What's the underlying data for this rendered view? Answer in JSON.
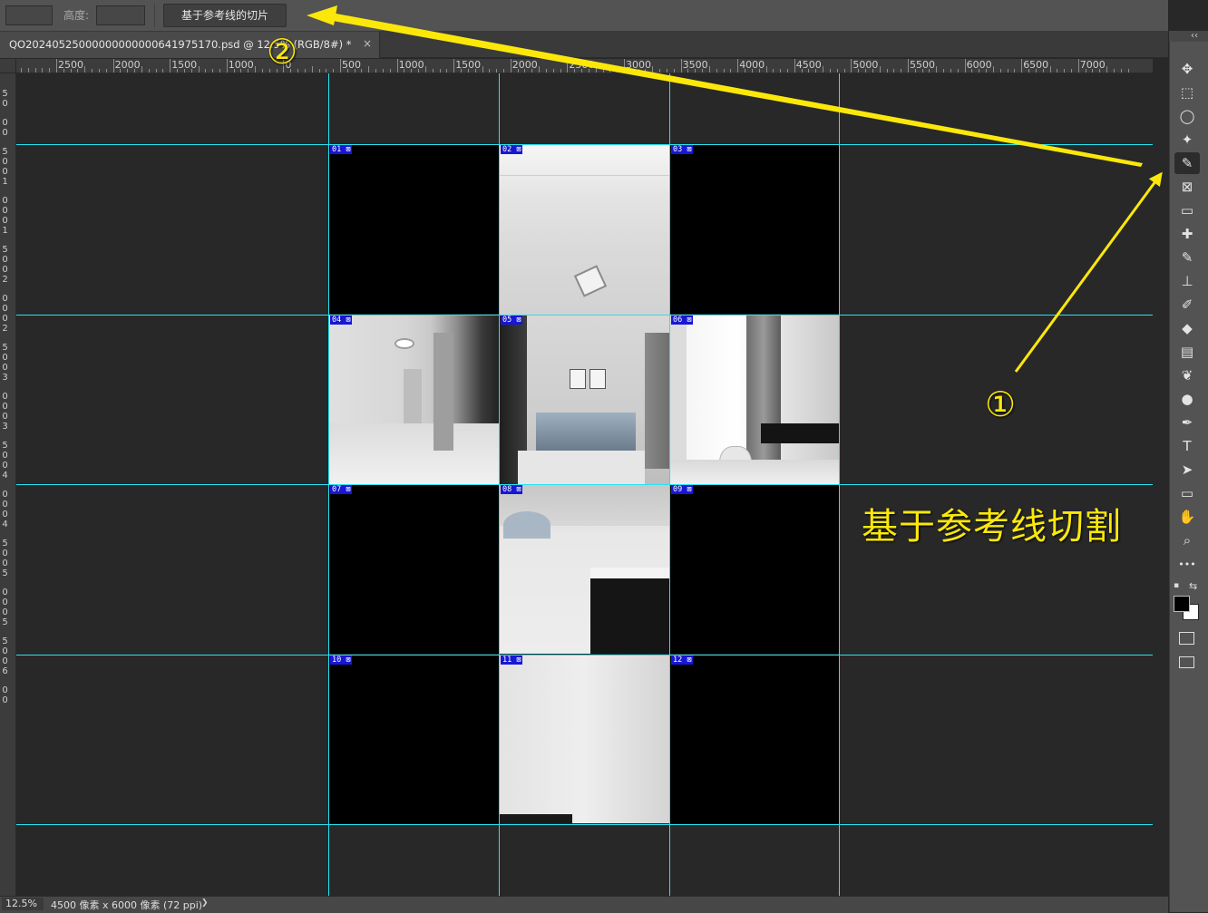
{
  "options_bar": {
    "height_label": "高度:",
    "slice_button": "基于参考线的切片"
  },
  "document_tab": {
    "title": "QO20240525000000000000641975170.psd @ 12.5% (RGB/8#) *",
    "close_label": "×"
  },
  "ruler": {
    "h_labels": [
      "2500",
      "2000",
      "1500",
      "1000",
      "0",
      "500",
      "1000",
      "1500",
      "2000",
      "2500",
      "3000",
      "3500",
      "4000",
      "4500",
      "5000",
      "5500",
      "6000",
      "6500",
      "7000"
    ],
    "v_labels": [
      "5",
      "0",
      "0",
      "0",
      "5",
      "0",
      "0",
      "1",
      "0",
      "0",
      "0",
      "1",
      "5",
      "0",
      "0",
      "2",
      "0",
      "0",
      "0",
      "2",
      "5",
      "0",
      "0",
      "3",
      "0",
      "0",
      "0",
      "3",
      "5",
      "0",
      "0",
      "4",
      "0",
      "0",
      "0",
      "4",
      "5",
      "0",
      "0",
      "5",
      "0",
      "0",
      "0",
      "5",
      "5",
      "0",
      "0",
      "6",
      "0",
      "0"
    ]
  },
  "slices": [
    {
      "id": "01",
      "image": "black"
    },
    {
      "id": "02",
      "image": "ceiling-light"
    },
    {
      "id": "03",
      "image": "black"
    },
    {
      "id": "04",
      "image": "corridor"
    },
    {
      "id": "05",
      "image": "bedroom"
    },
    {
      "id": "06",
      "image": "window-desk"
    },
    {
      "id": "07",
      "image": "black"
    },
    {
      "id": "08",
      "image": "floor-bed-end"
    },
    {
      "id": "09",
      "image": "black"
    },
    {
      "id": "10",
      "image": "black"
    },
    {
      "id": "11",
      "image": "wall-white"
    },
    {
      "id": "12",
      "image": "black"
    }
  ],
  "annotations": {
    "caption": "基于参考线切割",
    "marker_1": "①",
    "marker_2": "②",
    "arrow_color": "#fbe80a"
  },
  "status_bar": {
    "zoom": "12.5%",
    "dimensions": "4500 像素 x 6000 像素 (72 ppi)",
    "expand_arrow": "❯"
  },
  "tools": {
    "collapse": "‹‹",
    "items": [
      {
        "name": "move-tool",
        "glyph": "✥"
      },
      {
        "name": "marquee-tool",
        "glyph": "⬚"
      },
      {
        "name": "lasso-tool",
        "glyph": "◯"
      },
      {
        "name": "magic-wand-tool",
        "glyph": "✦"
      },
      {
        "name": "slice-tool",
        "glyph": "✎",
        "active": true
      },
      {
        "name": "frame-tool",
        "glyph": "⊠"
      },
      {
        "name": "ruler-tool",
        "glyph": "▭"
      },
      {
        "name": "healing-tool",
        "glyph": "✚"
      },
      {
        "name": "brush-tool",
        "glyph": "✎"
      },
      {
        "name": "stamp-tool",
        "glyph": "⊥"
      },
      {
        "name": "history-brush-tool",
        "glyph": "✐"
      },
      {
        "name": "eraser-tool",
        "glyph": "◆"
      },
      {
        "name": "gradient-tool",
        "glyph": "▤"
      },
      {
        "name": "blur-tool",
        "glyph": "❦"
      },
      {
        "name": "dodge-tool",
        "glyph": "●"
      },
      {
        "name": "pen-tool",
        "glyph": "✒"
      },
      {
        "name": "type-tool",
        "glyph": "T"
      },
      {
        "name": "path-select-tool",
        "glyph": "➤"
      },
      {
        "name": "rectangle-tool",
        "glyph": "▭"
      },
      {
        "name": "hand-tool",
        "glyph": "✋"
      },
      {
        "name": "zoom-tool",
        "glyph": "⌕"
      },
      {
        "name": "more-tools",
        "glyph": "•••"
      }
    ]
  }
}
